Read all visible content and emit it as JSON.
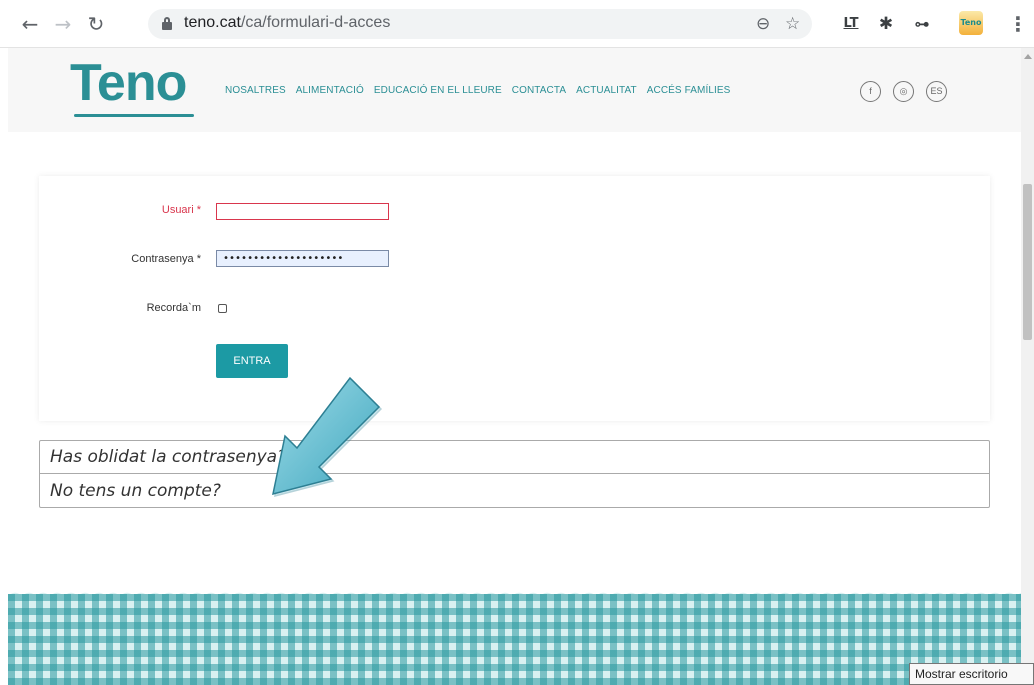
{
  "browser": {
    "url_host": "teno.cat",
    "url_path": "/ca/formulari-d-acces",
    "back_icon": "back-arrow-icon",
    "forward_icon": "forward-arrow-icon",
    "reload_icon": "reload-icon",
    "zoom_icon": "zoom-out-icon",
    "star_icon": "bookmark-star-icon",
    "ext_lt": "LT",
    "ext_teno": "Teno",
    "menu": "⋮"
  },
  "site": {
    "logo": "Teno",
    "nav": [
      "NOSALTRES",
      "ALIMENTACIÓ",
      "EDUCACIÓ EN EL LLEURE",
      "CONTACTA",
      "ACTUALITAT",
      "ACCÉS FAMÍLIES"
    ],
    "social": {
      "facebook": "f",
      "instagram": "◎",
      "language": "ES"
    }
  },
  "form": {
    "user_label": "Usuari *",
    "user_value": "",
    "password_label": "Contrasenya *",
    "password_value": "••••••••••••••••••••",
    "remember_label": "Recorda`m",
    "remember_checked": false,
    "submit_label": "ENTRA"
  },
  "links": {
    "forgot_password": "Has oblidat la contrasenya?",
    "no_account": "No tens un compte?"
  },
  "colors": {
    "accent": "#1c9aa4",
    "logo": "#2b8f95",
    "error": "#d9364d",
    "arrow": "#4fb6cc"
  },
  "tooltip": "Mostrar escritorio"
}
